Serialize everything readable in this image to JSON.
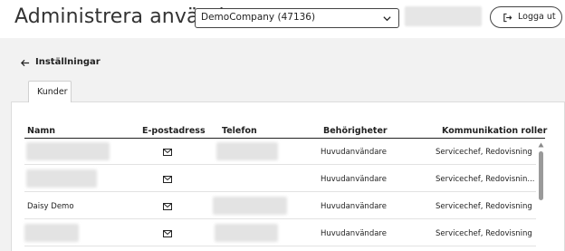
{
  "header": {
    "title": "Administrera användare",
    "company_select": {
      "value": "DemoCompany (47136)",
      "icon": "chevron-down-icon"
    },
    "logout": {
      "label": "Logga ut",
      "icon": "logout-icon"
    }
  },
  "back_link": {
    "label": "Inställningar",
    "icon": "arrow-left-icon"
  },
  "tabs": [
    {
      "label": "Kunder",
      "active": true
    }
  ],
  "table": {
    "columns": [
      "Namn",
      "E-postadress",
      "Telefon",
      "Behörigheter",
      "Kommunikation roller"
    ],
    "rows": [
      {
        "name": "",
        "permissions": "Huvudanvändare",
        "roles": "Servicechef, Redovisning"
      },
      {
        "name": "",
        "permissions": "Huvudanvändare",
        "roles": "Servicechef, Redovisnin..."
      },
      {
        "name": "Daisy Demo",
        "permissions": "Huvudanvändare",
        "roles": "Servicechef, Redovisning"
      },
      {
        "name": "",
        "permissions": "Huvudanvändare",
        "roles": "Servicechef, Redovisning"
      }
    ]
  },
  "colors": {
    "accent_border": "#444444",
    "scroll_thumb": "#9a9a9a"
  }
}
